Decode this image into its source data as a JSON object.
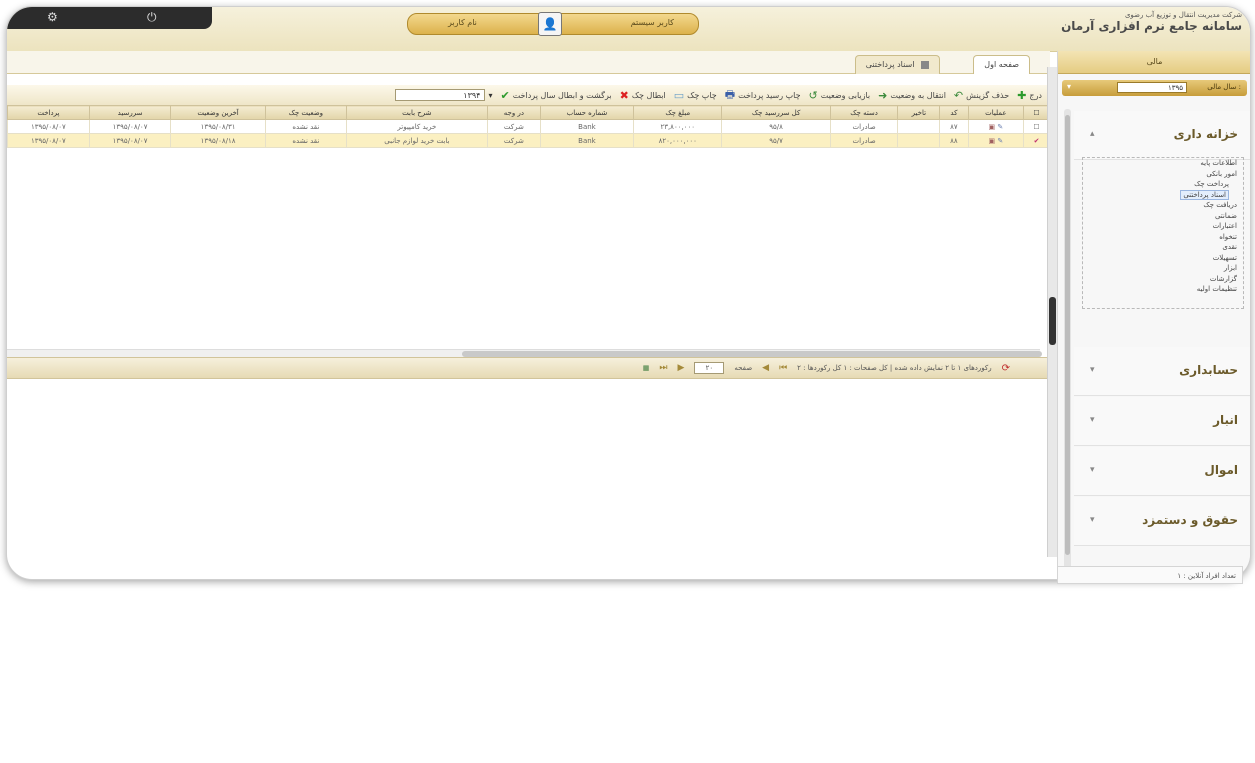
{
  "header": {
    "company": "شرکت مدیریت انتقال و توزیع آب رضوی",
    "app_title": "سامانه جامع نرم افزاری آرمان",
    "user_name": "نام کاربر",
    "user_role": "کاربر سیستم"
  },
  "tabs": [
    {
      "label": "صفحه اول"
    },
    {
      "label": "اسناد پرداختنی"
    }
  ],
  "toolbar": {
    "buttons": [
      "درج",
      "حذف گزینش",
      "انتقال به وضعیت",
      "بازیابی وضعیت",
      "چاپ رسید پرداخت",
      "چاپ چک",
      "ابطال چک",
      "برگشت و ابطال سال پرداخت"
    ],
    "year_value": "۱۳۹۴"
  },
  "grid": {
    "columns": [
      "عملیات",
      "کد",
      "تاخیر",
      "دسته چک",
      "کل سررسید چک",
      "مبلغ چک",
      "شماره حساب",
      "در وجه",
      "شرح بابت",
      "وضعیت چک",
      "آخرین وضعیت",
      "سررسید",
      "پرداخت"
    ],
    "rows": [
      {
        "code": "۸۷",
        "book": "صادرات",
        "due": "۹۵/۸",
        "amount": "۲۳,۸۰۰,۰۰۰",
        "account": "Bank",
        "payee": "شرکت",
        "desc": "خرید کامپیوتر",
        "status": "نقد نشده",
        "last": "۱۳۹۵/۰۸/۳۱",
        "date1": "۱۳۹۵/۰۸/۰۷",
        "date2": "۱۳۹۵/۰۸/۰۷"
      },
      {
        "code": "۸۸",
        "book": "صادرات",
        "due": "۹۵/۷",
        "amount": "۸۲۰,۰۰۰,۰۰۰",
        "account": "Bank",
        "payee": "شرکت",
        "desc": "بابت خرید لوازم جانبی",
        "status": "نقد نشده",
        "last": "۱۳۹۵/۰۸/۱۸",
        "date1": "۱۳۹۵/۰۸/۰۷",
        "date2": "۱۳۹۵/۰۸/۰۷"
      }
    ]
  },
  "pager": {
    "summary": "رکوردهای ۱ تا ۲ نمایش داده شده | کل صفحات : ۱ کل رکوردها : ۲",
    "page_size": "۲۰",
    "page_label": "صفحه"
  },
  "sidebar": {
    "header": "مالی",
    "year_label": "سال مالی :",
    "year_value": "۱۳۹۵",
    "modules": [
      "خزانه داری",
      "حسابداری",
      "انبار",
      "اموال",
      "حقوق و دستمزد"
    ],
    "tree": [
      {
        "label": "اطلاعات پایه",
        "level": 0
      },
      {
        "label": "امور بانکی",
        "level": 0
      },
      {
        "label": "پرداخت چک",
        "level": 1
      },
      {
        "label": "اسناد پرداختنی",
        "level": 1,
        "selected": true
      },
      {
        "label": "دریافت چک",
        "level": 0
      },
      {
        "label": "ضمانتی",
        "level": 0
      },
      {
        "label": "اعتبارات",
        "level": 0
      },
      {
        "label": "تنخواه",
        "level": 0
      },
      {
        "label": "نقدی",
        "level": 0
      },
      {
        "label": "تسهیلات",
        "level": 0
      },
      {
        "label": "ابزار",
        "level": 0
      },
      {
        "label": "گزارشات",
        "level": 0
      },
      {
        "label": "تنظیمات اولیه",
        "level": 0
      }
    ],
    "footer": "تعداد افراد آنلاین : ۱"
  }
}
